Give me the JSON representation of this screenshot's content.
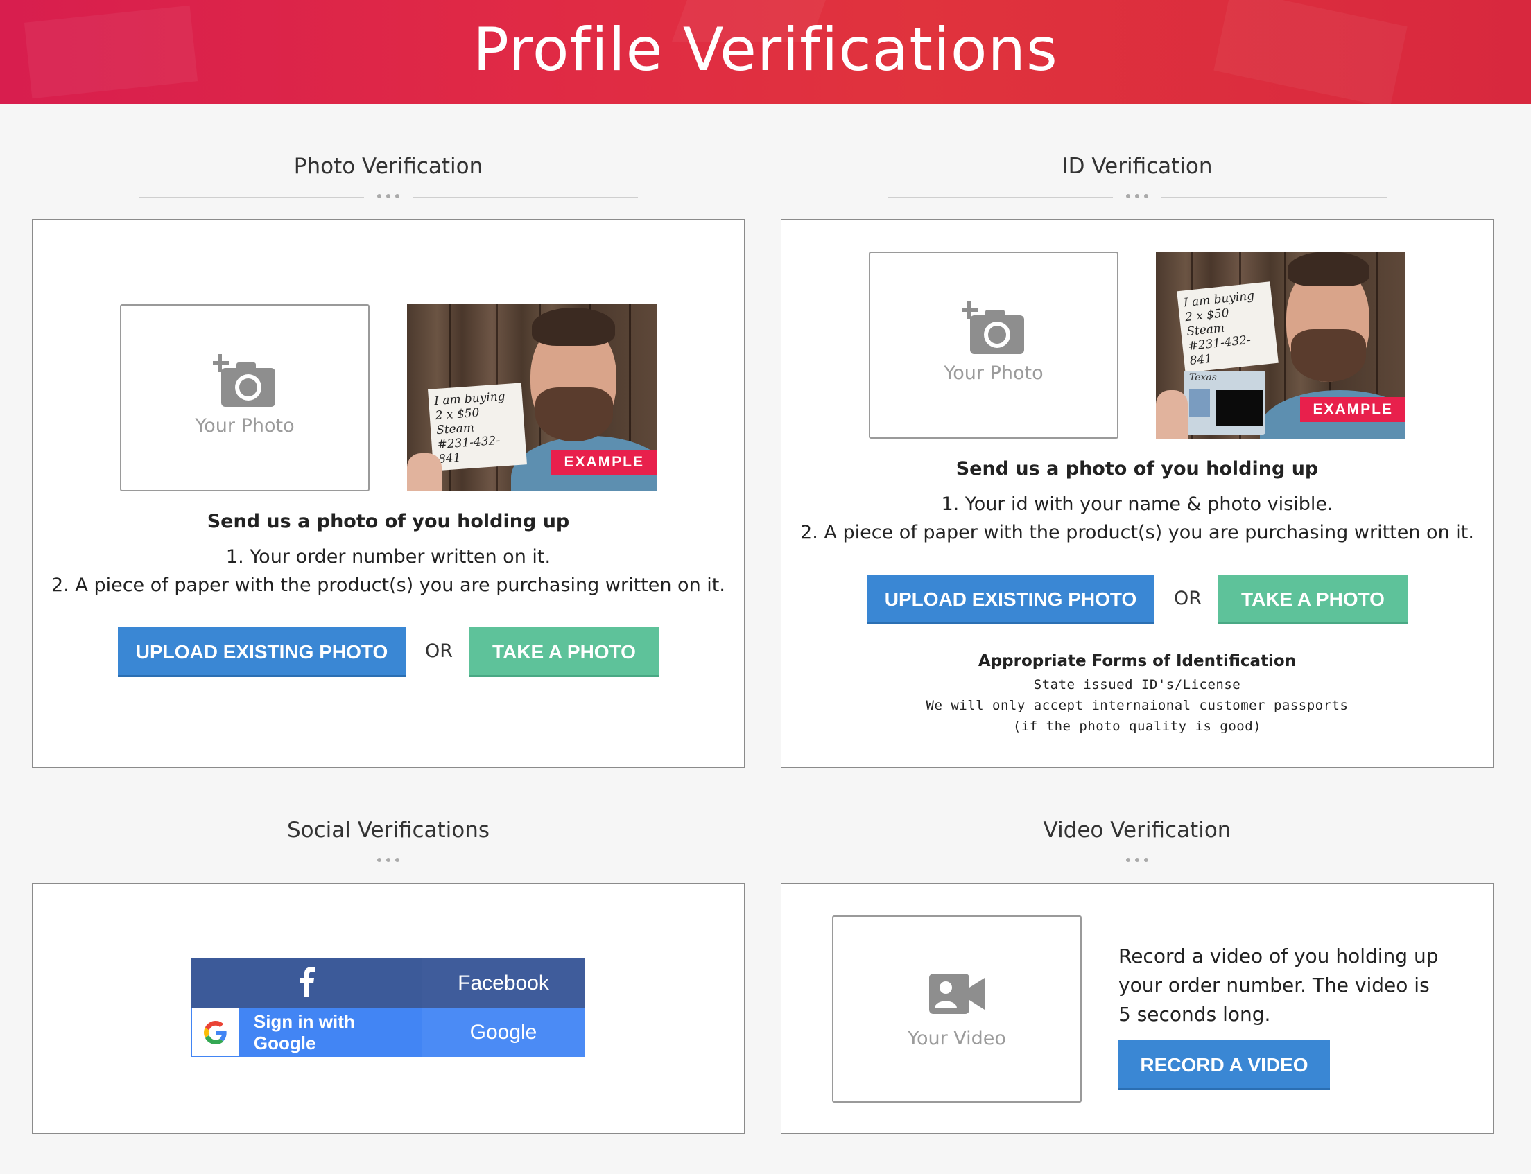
{
  "header": {
    "title": "Profile Verifications"
  },
  "photo_verification": {
    "heading": "Photo Verification",
    "placeholder_label": "Your Photo",
    "example_badge": "EXAMPLE",
    "example_note": [
      "I am buying",
      "2 x $50 Steam",
      "#231-432-841"
    ],
    "lead": "Send us a photo of you holding up",
    "steps": [
      "1. Your order number written on it.",
      "2. A piece of paper with the product(s) you are purchasing written on it."
    ],
    "upload_label": "UPLOAD EXISTING PHOTO",
    "or_label": "OR",
    "take_label": "TAKE A PHOTO"
  },
  "id_verification": {
    "heading": "ID Verification",
    "placeholder_label": "Your Photo",
    "example_badge": "EXAMPLE",
    "example_note": [
      "I am buying",
      "2 x $50 Steam",
      "#231-432-841"
    ],
    "id_card_state": "Texas",
    "lead": "Send us a photo of you holding up",
    "steps": [
      "1. Your id with your name & photo visible.",
      "2. A piece of paper with the product(s) you are purchasing written on it."
    ],
    "upload_label": "UPLOAD EXISTING PHOTO",
    "or_label": "OR",
    "take_label": "TAKE A PHOTO",
    "forms_heading": "Appropriate Forms of Identification",
    "forms_lines": [
      "State issued ID's/License",
      "We will only accept internaional customer passports",
      "(if the photo quality is good)"
    ]
  },
  "social_verification": {
    "heading": "Social Verifications",
    "facebook_label": "Facebook",
    "google_signin_label": "Sign in with Google",
    "google_label": "Google"
  },
  "video_verification": {
    "heading": "Video Verification",
    "placeholder_label": "Your Video",
    "description": "Record a video of you holding up your order number. The video is 5 seconds long.",
    "record_label": "RECORD A VIDEO"
  },
  "colors": {
    "banner": "#dd2a45",
    "primary_button": "#3a87d4",
    "secondary_button": "#5ec29a",
    "example_badge": "#e8204c",
    "facebook": "#3c5a99",
    "google": "#4285f4"
  }
}
